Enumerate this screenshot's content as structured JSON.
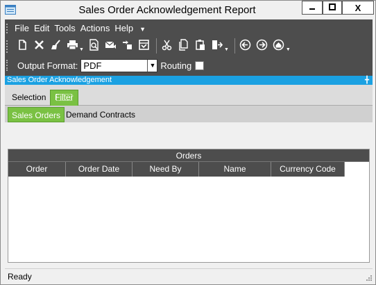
{
  "window": {
    "title": "Sales Order Acknowledgement Report",
    "minimize_label": "",
    "maximize_label": "",
    "close_label": "X"
  },
  "menu": {
    "items": [
      "File",
      "Edit",
      "Tools",
      "Actions",
      "Help"
    ]
  },
  "toolbar": {
    "icons": [
      "new-icon",
      "delete-icon",
      "clear-icon",
      "print-icon",
      "print-preview-icon",
      "email-icon",
      "generate-icon",
      "schedule-icon",
      "cut-icon",
      "copy-icon",
      "paste-icon",
      "exit-icon",
      "back-icon",
      "forward-icon",
      "home-icon"
    ]
  },
  "output": {
    "label": "Output Format:",
    "value": "PDF",
    "routing_label": "Routing",
    "routing_checked": false
  },
  "panel": {
    "title": "Sales Order Acknowledgement"
  },
  "tabs_main": [
    {
      "label": "Selection",
      "selected": false
    },
    {
      "label": "Filter",
      "selected": true
    }
  ],
  "tabs_sub": [
    {
      "label": "Sales Orders",
      "selected": true
    },
    {
      "label": "Demand Contracts",
      "selected": false
    }
  ],
  "grid": {
    "title": "Orders",
    "columns": [
      "Order",
      "Order Date",
      "Need By",
      "Name",
      "Currency Code"
    ],
    "rows": []
  },
  "status": {
    "text": "Ready"
  },
  "colors": {
    "accent_blue": "#1ba1e2",
    "accent_green": "#7ac143",
    "dark_bar": "#4d4d4d"
  }
}
